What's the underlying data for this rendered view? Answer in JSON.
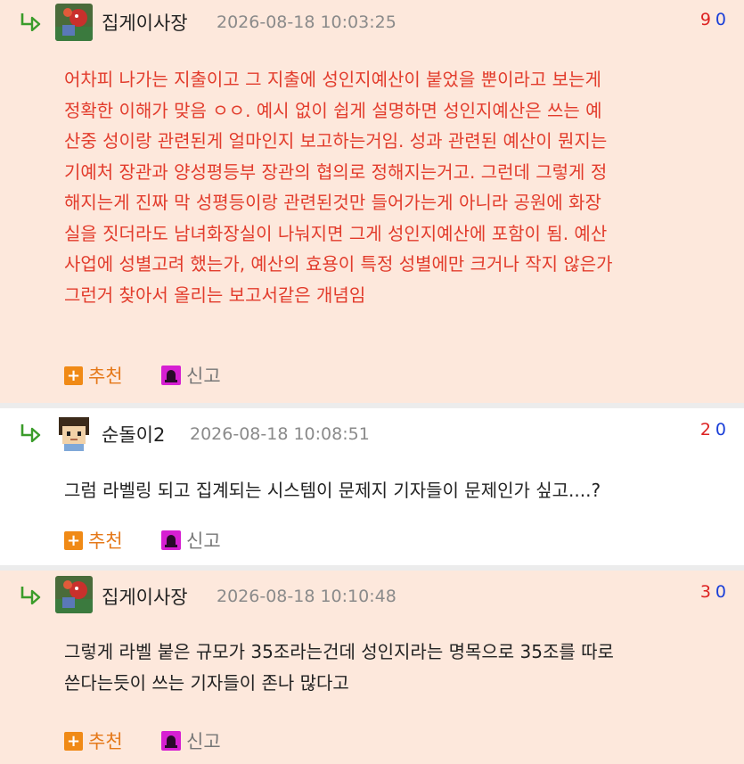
{
  "comments": [
    {
      "nick": "집게이사장",
      "date": "2026-08-18 10:03:25",
      "up": "9",
      "down": "0",
      "avatar": "crab-character-avatar",
      "lines": [
        "어차피 나가는 지출이고 그 지출에 성인지예산이 붙었을 뿐이라고 보는게",
        "정확한 이해가 맞음 ㅇㅇ. 예시 없이 쉽게 설명하면 성인지예산은 쓰는 예",
        "산중 성이랑 관련된게 얼마인지 보고하는거임. 성과 관련된 예산이 뭔지는",
        "기예처 장관과 양성평등부 장관의 협의로 정해지는거고. 그런데 그렇게 정",
        "해지는게 진짜 막 성평등이랑 관련된것만 들어가는게 아니라 공원에 화장",
        "실을 짓더라도 남녀화장실이 나눠지면 그게 성인지예산에 포함이 됨. 예산",
        "사업에 성별고려 했는가, 예산의 효용이 특정 성별에만 크거나 작지 않은가",
        "그런거 찾아서 올리는 보고서같은 개념임"
      ],
      "recommend": "추천",
      "report": "신고"
    },
    {
      "nick": "순돌이2",
      "date": "2026-08-18 10:08:51",
      "up": "2",
      "down": "0",
      "avatar": "pixel-character-avatar",
      "lines": [
        "그럼 라벨링 되고 집계되는 시스템이 문제지 기자들이 문제인가 싶고....?"
      ],
      "recommend": "추천",
      "report": "신고"
    },
    {
      "nick": "집게이사장",
      "date": "2026-08-18 10:10:48",
      "up": "3",
      "down": "0",
      "avatar": "crab-character-avatar",
      "lines": [
        "그렇게 라벨 붙은 규모가 35조라는건데 성인지라는 명목으로 35조를 따로",
        "쓴다는듯이 쓰는 기자들이 존나 많다고"
      ],
      "recommend": "추천",
      "report": "신고"
    }
  ],
  "icons": {
    "reply": "reply-arrow-icon",
    "recommend": "plus-icon",
    "report": "siren-icon"
  },
  "colors": {
    "highlight_bg": "#fde8dc",
    "highlight_text": "#e23c2c",
    "up_vote": "#d22222",
    "down_vote": "#1a3fd8",
    "recommend": "#e5791a",
    "report_icon": "#d61fd2"
  }
}
